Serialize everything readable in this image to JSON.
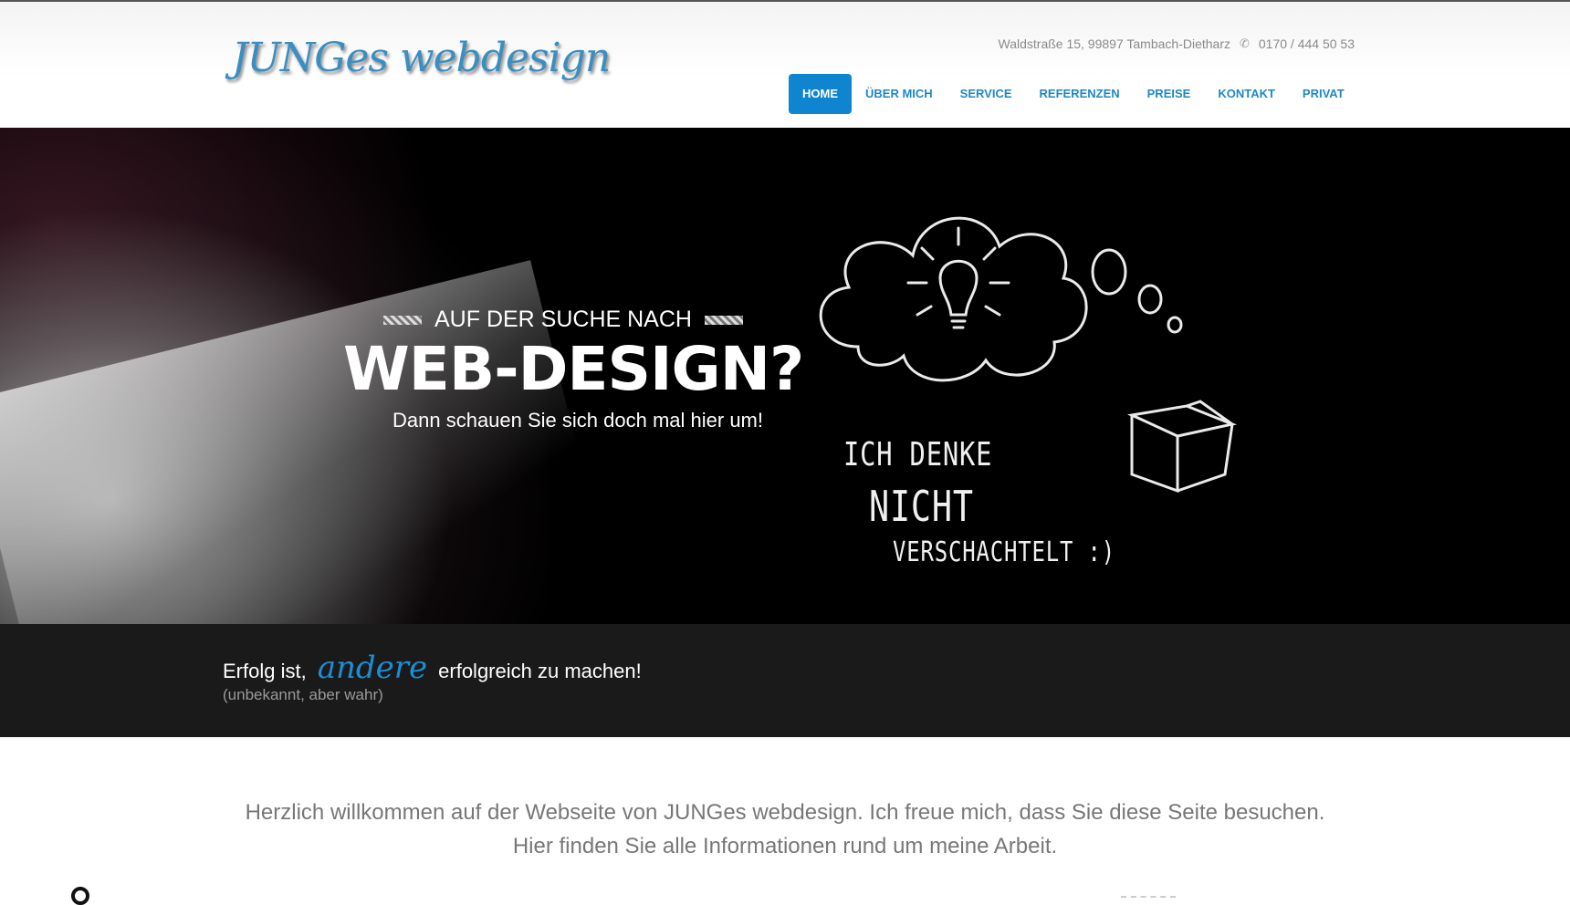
{
  "header": {
    "logo": "JUNGes webdesign",
    "address": "Waldstraße 15, 99897 Tambach-Dietharz",
    "phone": "0170 / 444 50 53",
    "nav": [
      {
        "label": "HOME",
        "active": true
      },
      {
        "label": "ÜBER MICH",
        "active": false
      },
      {
        "label": "SERVICE",
        "active": false
      },
      {
        "label": "REFERENZEN",
        "active": false
      },
      {
        "label": "PREISE",
        "active": false
      },
      {
        "label": "KONTAKT",
        "active": false
      },
      {
        "label": "PRIVAT",
        "active": false
      }
    ]
  },
  "hero": {
    "pretitle": "AUF DER SUCHE NACH",
    "title": "WEB-DESIGN?",
    "tagline": "Dann schauen Sie sich doch mal hier um!",
    "chalk_line1": "ICH DENKE",
    "chalk_line2": "NICHT",
    "chalk_line3": "VERSCHACHTELT :)"
  },
  "quote": {
    "before": "Erfolg ist,",
    "accent": "andere",
    "after": "erfolgreich zu machen!",
    "source": "(unbekannt, aber wahr)"
  },
  "welcome": {
    "line1": "Herzlich willkommen auf der Webseite von JUNGes webdesign. Ich freue mich, dass Sie diese Seite besuchen.",
    "line2": "Hier finden Sie alle Informationen rund um meine Arbeit."
  },
  "colors": {
    "accent": "#0f85d0",
    "nav_text": "#1e88c7",
    "quote_band": "#1a1a1a"
  }
}
